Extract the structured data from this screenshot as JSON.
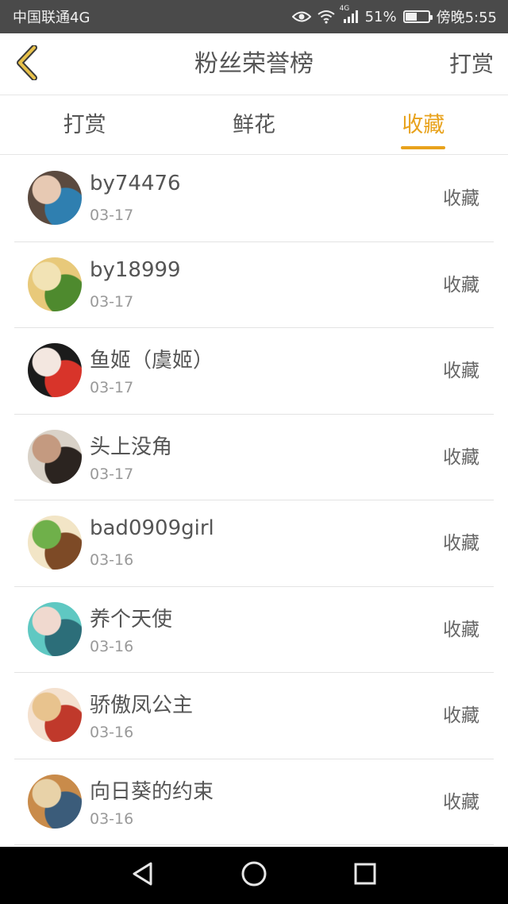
{
  "status_bar": {
    "carrier": "中国联通4G",
    "battery": "51%",
    "battery_level": 0.51,
    "time": "傍晚5:55",
    "network_label": "4G"
  },
  "header": {
    "title": "粉丝荣誉榜",
    "action_label": "打赏",
    "back_icon": "chevron-left-icon"
  },
  "tabs": [
    {
      "label": "打赏",
      "active": false
    },
    {
      "label": "鲜花",
      "active": false
    },
    {
      "label": "收藏",
      "active": true
    }
  ],
  "colors": {
    "accent": "#e8a21c",
    "status_bar_bg": "#4a4a4a",
    "nav_bar_bg": "#000000"
  },
  "list": [
    {
      "name": "by74476",
      "date": "03-17",
      "action": "收藏",
      "avatar_colors": [
        "#5b4a3f",
        "#2f7fb0",
        "#e7c9b3"
      ]
    },
    {
      "name": "by18999",
      "date": "03-17",
      "action": "收藏",
      "avatar_colors": [
        "#e8c97a",
        "#4e8a2e",
        "#f2e3b5"
      ]
    },
    {
      "name": "鱼姬（虞姬）",
      "date": "03-17",
      "action": "收藏",
      "avatar_colors": [
        "#1b1b1b",
        "#d8342a",
        "#f3e7e0"
      ]
    },
    {
      "name": "头上没角",
      "date": "03-17",
      "action": "收藏",
      "avatar_colors": [
        "#d9d2c8",
        "#2b2420",
        "#c49a80"
      ]
    },
    {
      "name": "bad0909girl",
      "date": "03-16",
      "action": "收藏",
      "avatar_colors": [
        "#f2e5c6",
        "#7d4a26",
        "#6fb04a"
      ]
    },
    {
      "name": "养个天使",
      "date": "03-16",
      "action": "收藏",
      "avatar_colors": [
        "#5fc8c2",
        "#2c6e79",
        "#f0d9cf"
      ]
    },
    {
      "name": "骄傲凤公主",
      "date": "03-16",
      "action": "收藏",
      "avatar_colors": [
        "#f4e1cf",
        "#c0392b",
        "#e8c38e"
      ]
    },
    {
      "name": "向日葵的约束",
      "date": "03-16",
      "action": "收藏",
      "avatar_colors": [
        "#c98b4a",
        "#3b5c7a",
        "#e8d2a8"
      ]
    }
  ],
  "nav_bar": {
    "back_icon": "triangle-back-icon",
    "home_icon": "circle-home-icon",
    "recents_icon": "square-recents-icon"
  }
}
